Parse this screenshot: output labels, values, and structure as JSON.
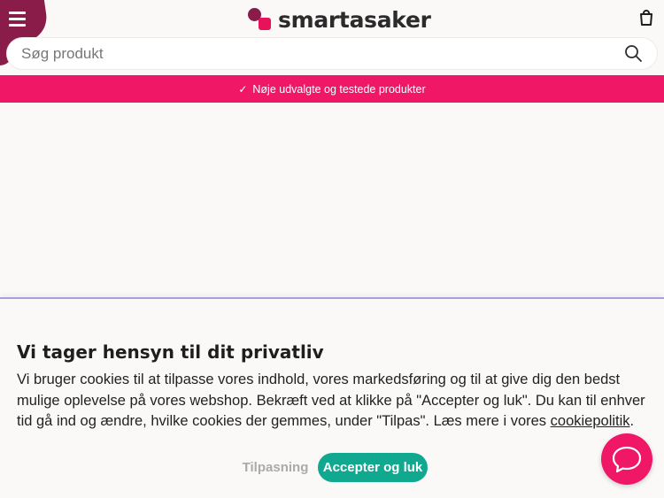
{
  "header": {
    "logo_text": "smartasaker",
    "search_placeholder": "Søg produkt"
  },
  "promo_bar": {
    "text": "Nøje udvalgte og testede produkter",
    "check_glyph": "✓"
  },
  "cookie_banner": {
    "title": "Vi tager hensyn til dit privatliv",
    "body_text": "Vi bruger cookies til at tilpasse vores indhold, vores markedsføring og til at give dig den bedst mulige oplevelse på vores webshop. Bekræft ved at klikke på \"Accepter og luk\". Du kan til enhver tid gå ind og ændre, hvilke cookies der gemmes, under \"Tilpas\". Læs mere i vores ",
    "policy_link": "cookiepolitik",
    "body_end": ".",
    "customize_label": "Tilpasning",
    "accept_label": "Accepter og luk"
  },
  "icons": {
    "menu": "menu-icon",
    "bag": "shopping-bag-icon",
    "search": "search-icon",
    "chat": "chat-icon"
  },
  "colors": {
    "brand_dark": "#8a1c4a",
    "brand_pink": "#ef1766",
    "accept_green": "#11a890",
    "background": "#fbf9f8"
  }
}
